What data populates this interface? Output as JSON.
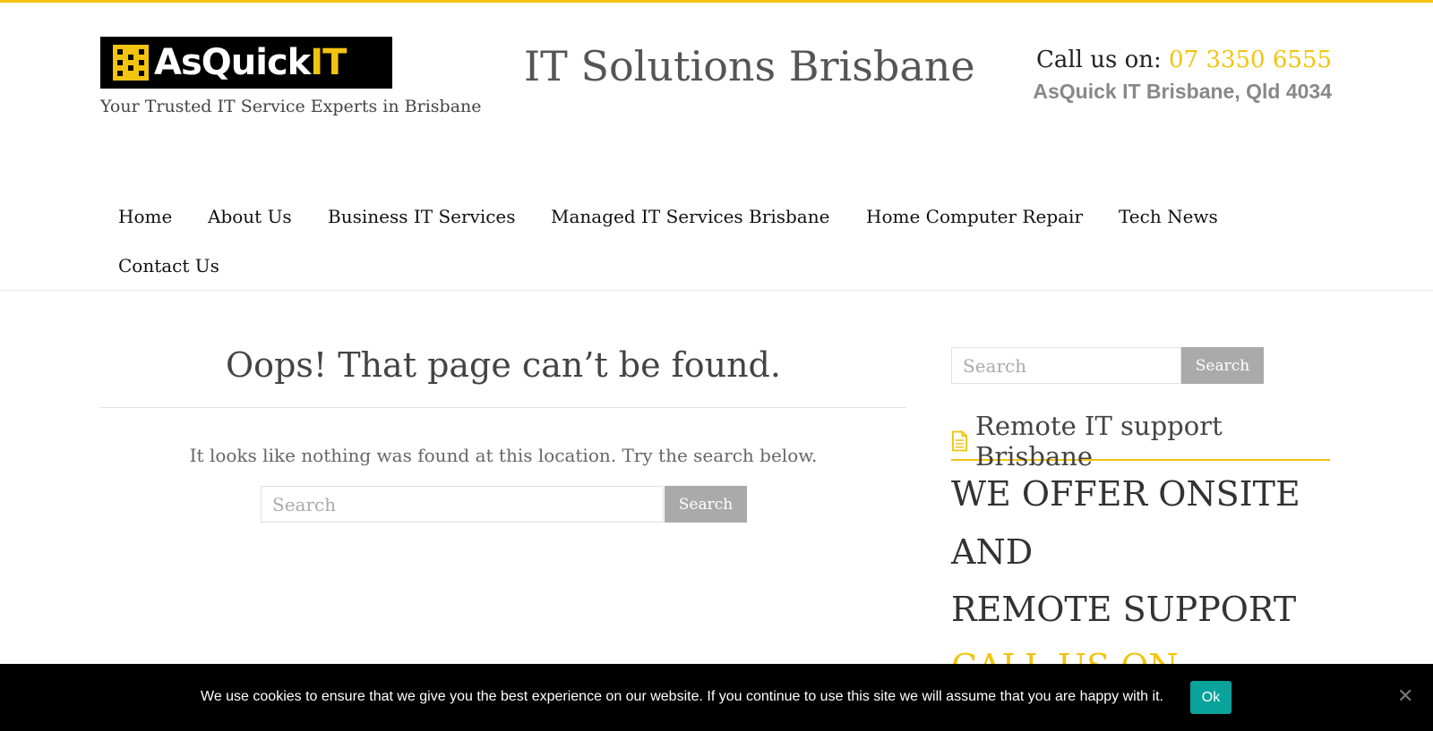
{
  "header": {
    "logo_text_white": "AsQuick",
    "logo_text_yellow": "IT",
    "tagline": "Your Trusted IT Service Experts in Brisbane",
    "site_title": "IT Solutions Brisbane",
    "call_label": "Call us on:",
    "phone": "07 3350 6555",
    "address": "AsQuick IT Brisbane, Qld 4034"
  },
  "nav": {
    "items": [
      {
        "label": "Home"
      },
      {
        "label": "About Us"
      },
      {
        "label": "Business IT Services"
      },
      {
        "label": "Managed IT Services Brisbane"
      },
      {
        "label": "Home Computer Repair"
      },
      {
        "label": "Tech News"
      },
      {
        "label": "Contact Us"
      }
    ]
  },
  "main": {
    "title": "Oops! That page can’t be found.",
    "message": "It looks like nothing was found at this location. Try the search below.",
    "search_placeholder": "Search",
    "search_button": "Search"
  },
  "sidebar": {
    "search_placeholder": "Search",
    "search_button": "Search",
    "widget_title": "Remote IT support Brisbane",
    "widget_icon": "document-icon",
    "offer_lines": [
      "WE OFFER ONSITE",
      "AND",
      "REMOTE SUPPORT"
    ],
    "offer_call": "CALL US ON"
  },
  "cookie": {
    "message": "We use cookies to ensure that we give you the best experience on our website. If you continue to use this site we will assume that you are happy with it.",
    "ok_label": "Ok",
    "close_label": "✕"
  },
  "colors": {
    "accent": "#f2c40f",
    "cookie_button": "#0aa39b",
    "search_button": "#aaaaaa"
  }
}
